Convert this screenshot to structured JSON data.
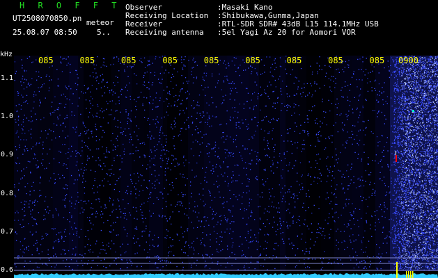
{
  "header": {
    "app_title": "H R O F F T",
    "filename": "UT2508070850.pn",
    "meteor_label": "meteor",
    "timestamp": "25.08.07 08:50",
    "count": "5..",
    "fields": [
      {
        "label": "Observer",
        "value": ":Masaki Kano"
      },
      {
        "label": "Receiving Location",
        "value": ":Shibukawa,Gunma,Japan"
      },
      {
        "label": "Receiver",
        "value": ":RTL-SDR SDR# 43dB L15 114.1MHz USB"
      },
      {
        "label": "Receiving antenna",
        "value": ":5el Yagi Az 20 for Aomori VOR"
      }
    ]
  },
  "chart_data": {
    "type": "heatmap",
    "ylabel": "kHz",
    "y_ticks": [
      "1.1",
      "1.0",
      "0.9",
      "0.8",
      "0.7",
      "0.6"
    ],
    "x_ticks": [
      "085",
      "085",
      "085",
      "085",
      "085",
      "085",
      "085",
      "085",
      "085",
      "0900"
    ],
    "ylim": [
      0.58,
      1.16
    ],
    "colors": {
      "background": "#000000",
      "noise_low": "#0a0a66",
      "noise_high": "#3a4cff",
      "signal": "#ffffff",
      "signal_bright": "#ff0000",
      "baseline": "#33ccff",
      "marker": "#ffff00"
    }
  }
}
